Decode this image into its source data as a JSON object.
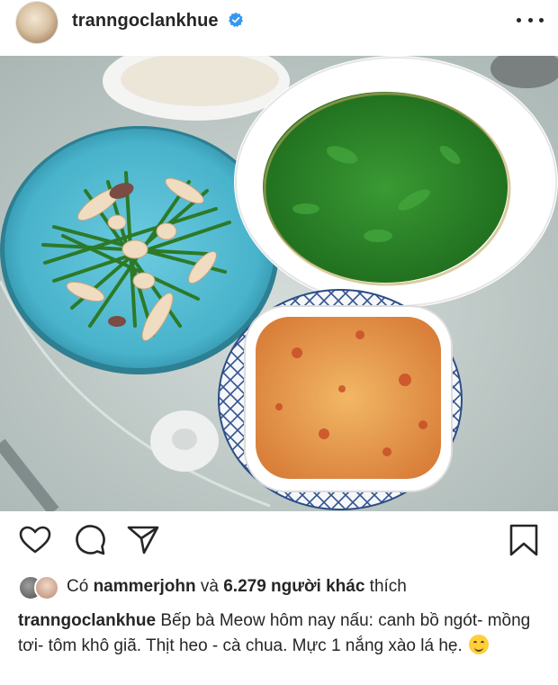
{
  "post": {
    "username": "tranngoclankhue",
    "verified": true,
    "more_icon": "more-horizontal-icon"
  },
  "photo": {
    "subject": "home-cooked meal: squid stir-fried with garlic chives, rice, leafy green soup, tomato and minced pork",
    "colors": {
      "table": "#c9d2cf",
      "blue_plate": "#4eb8cf",
      "soup_bowl": "#ffffff",
      "greens": "#2f8a2a",
      "tomato_dish": "#e79a4c"
    }
  },
  "actions": {
    "like_icon": "heart-icon",
    "comment_icon": "comment-icon",
    "share_icon": "send-icon",
    "save_icon": "bookmark-icon"
  },
  "likes": {
    "prefix": "Có ",
    "user": "nammerjohn",
    "middle": " và ",
    "others": "6.279 người khác",
    "suffix": " thích"
  },
  "caption": {
    "username": "tranngoclankhue",
    "text": " Bếp bà Meow hôm nay nấu: canh bồ ngót- mồng tơi- tôm khô giã. Thịt heo - cà chua. Mực 1 nắng xào lá hẹ.",
    "emoji": "smiling-face-savoring-food"
  }
}
